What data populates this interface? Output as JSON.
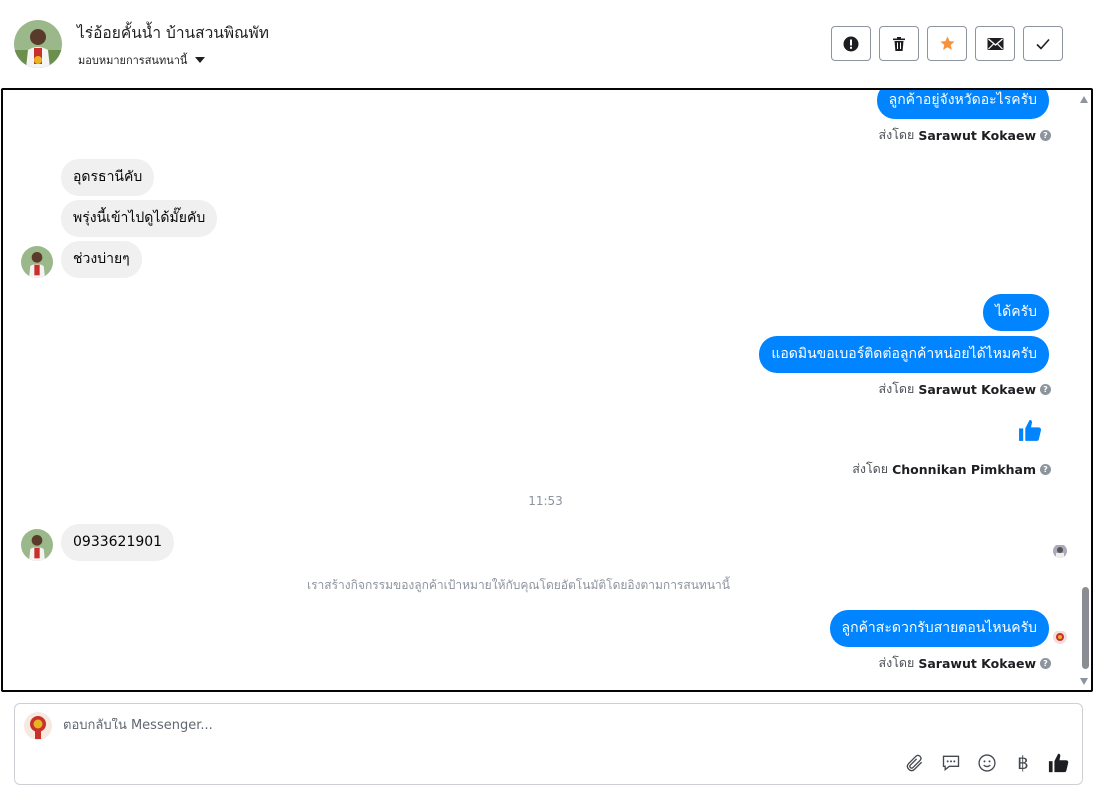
{
  "header": {
    "page_name": "ไร่อ้อยคั้นน้ำ บ้านสวนพิณพัท",
    "assign_label": "มอบหมายการสนทนานี้",
    "actions": [
      "mark-spam",
      "delete",
      "star",
      "mark-unread",
      "mark-done"
    ]
  },
  "messages": {
    "m1": "ลูกค้าอยู่จังหวัดอะไรครับ",
    "sent1_prefix": "ส่งโดย",
    "sent1_name": "Sarawut Kokaew",
    "m2": "อุดรธานีคับ",
    "m3": "พรุ่งนี้เข้าไปดูได้มั๊ยคับ",
    "m4": "ช่วงบ่ายๆ",
    "m5": "ได้ครับ",
    "m6": "แอดมินขอเบอร์ติดต่อลูกค้าหน่อยได้ไหมครับ",
    "sent2_prefix": "ส่งโดย",
    "sent2_name": "Sarawut Kokaew",
    "sent3_prefix": "ส่งโดย",
    "sent3_name": "Chonnikan Pimkham",
    "time": "11:53",
    "m7": "0933621901",
    "system": "เราสร้างกิจกรรมของลูกค้าเป้าหมายให้กับคุณโดยอัตโนมัติโดยอิงตามการสนทนานี้",
    "m8": "ลูกค้าสะดวกรับสายตอนไหนครับ",
    "sent4_prefix": "ส่งโดย",
    "sent4_name": "Sarawut Kokaew"
  },
  "composer": {
    "placeholder": "ตอบกลับใน Messenger...",
    "value": ""
  },
  "colors": {
    "outgoing": "#0084ff",
    "incoming": "#f0f0f0",
    "star": "#f7923b"
  }
}
